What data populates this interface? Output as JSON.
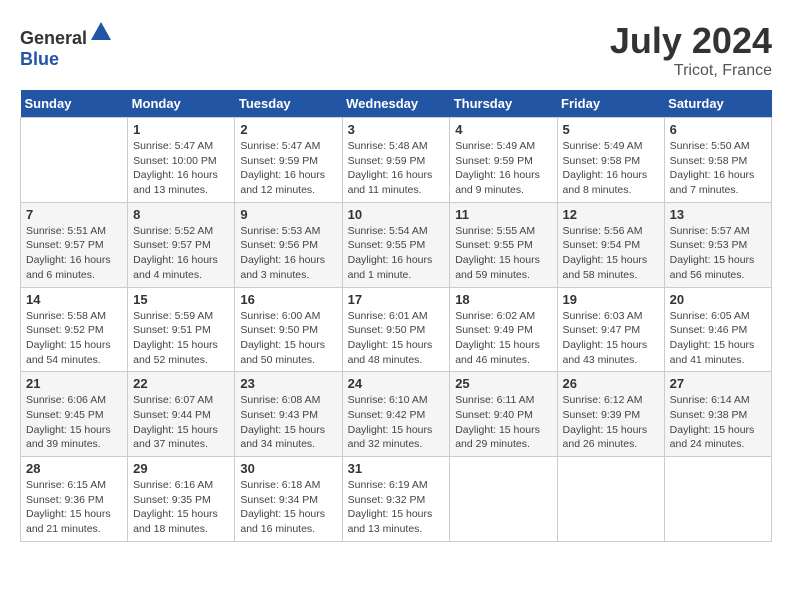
{
  "header": {
    "logo_general": "General",
    "logo_blue": "Blue",
    "month": "July 2024",
    "location": "Tricot, France"
  },
  "calendar": {
    "weekdays": [
      "Sunday",
      "Monday",
      "Tuesday",
      "Wednesday",
      "Thursday",
      "Friday",
      "Saturday"
    ],
    "weeks": [
      [
        {
          "day": "",
          "info": ""
        },
        {
          "day": "1",
          "info": "Sunrise: 5:47 AM\nSunset: 10:00 PM\nDaylight: 16 hours\nand 13 minutes."
        },
        {
          "day": "2",
          "info": "Sunrise: 5:47 AM\nSunset: 9:59 PM\nDaylight: 16 hours\nand 12 minutes."
        },
        {
          "day": "3",
          "info": "Sunrise: 5:48 AM\nSunset: 9:59 PM\nDaylight: 16 hours\nand 11 minutes."
        },
        {
          "day": "4",
          "info": "Sunrise: 5:49 AM\nSunset: 9:59 PM\nDaylight: 16 hours\nand 9 minutes."
        },
        {
          "day": "5",
          "info": "Sunrise: 5:49 AM\nSunset: 9:58 PM\nDaylight: 16 hours\nand 8 minutes."
        },
        {
          "day": "6",
          "info": "Sunrise: 5:50 AM\nSunset: 9:58 PM\nDaylight: 16 hours\nand 7 minutes."
        }
      ],
      [
        {
          "day": "7",
          "info": "Sunrise: 5:51 AM\nSunset: 9:57 PM\nDaylight: 16 hours\nand 6 minutes."
        },
        {
          "day": "8",
          "info": "Sunrise: 5:52 AM\nSunset: 9:57 PM\nDaylight: 16 hours\nand 4 minutes."
        },
        {
          "day": "9",
          "info": "Sunrise: 5:53 AM\nSunset: 9:56 PM\nDaylight: 16 hours\nand 3 minutes."
        },
        {
          "day": "10",
          "info": "Sunrise: 5:54 AM\nSunset: 9:55 PM\nDaylight: 16 hours\nand 1 minute."
        },
        {
          "day": "11",
          "info": "Sunrise: 5:55 AM\nSunset: 9:55 PM\nDaylight: 15 hours\nand 59 minutes."
        },
        {
          "day": "12",
          "info": "Sunrise: 5:56 AM\nSunset: 9:54 PM\nDaylight: 15 hours\nand 58 minutes."
        },
        {
          "day": "13",
          "info": "Sunrise: 5:57 AM\nSunset: 9:53 PM\nDaylight: 15 hours\nand 56 minutes."
        }
      ],
      [
        {
          "day": "14",
          "info": "Sunrise: 5:58 AM\nSunset: 9:52 PM\nDaylight: 15 hours\nand 54 minutes."
        },
        {
          "day": "15",
          "info": "Sunrise: 5:59 AM\nSunset: 9:51 PM\nDaylight: 15 hours\nand 52 minutes."
        },
        {
          "day": "16",
          "info": "Sunrise: 6:00 AM\nSunset: 9:50 PM\nDaylight: 15 hours\nand 50 minutes."
        },
        {
          "day": "17",
          "info": "Sunrise: 6:01 AM\nSunset: 9:50 PM\nDaylight: 15 hours\nand 48 minutes."
        },
        {
          "day": "18",
          "info": "Sunrise: 6:02 AM\nSunset: 9:49 PM\nDaylight: 15 hours\nand 46 minutes."
        },
        {
          "day": "19",
          "info": "Sunrise: 6:03 AM\nSunset: 9:47 PM\nDaylight: 15 hours\nand 43 minutes."
        },
        {
          "day": "20",
          "info": "Sunrise: 6:05 AM\nSunset: 9:46 PM\nDaylight: 15 hours\nand 41 minutes."
        }
      ],
      [
        {
          "day": "21",
          "info": "Sunrise: 6:06 AM\nSunset: 9:45 PM\nDaylight: 15 hours\nand 39 minutes."
        },
        {
          "day": "22",
          "info": "Sunrise: 6:07 AM\nSunset: 9:44 PM\nDaylight: 15 hours\nand 37 minutes."
        },
        {
          "day": "23",
          "info": "Sunrise: 6:08 AM\nSunset: 9:43 PM\nDaylight: 15 hours\nand 34 minutes."
        },
        {
          "day": "24",
          "info": "Sunrise: 6:10 AM\nSunset: 9:42 PM\nDaylight: 15 hours\nand 32 minutes."
        },
        {
          "day": "25",
          "info": "Sunrise: 6:11 AM\nSunset: 9:40 PM\nDaylight: 15 hours\nand 29 minutes."
        },
        {
          "day": "26",
          "info": "Sunrise: 6:12 AM\nSunset: 9:39 PM\nDaylight: 15 hours\nand 26 minutes."
        },
        {
          "day": "27",
          "info": "Sunrise: 6:14 AM\nSunset: 9:38 PM\nDaylight: 15 hours\nand 24 minutes."
        }
      ],
      [
        {
          "day": "28",
          "info": "Sunrise: 6:15 AM\nSunset: 9:36 PM\nDaylight: 15 hours\nand 21 minutes."
        },
        {
          "day": "29",
          "info": "Sunrise: 6:16 AM\nSunset: 9:35 PM\nDaylight: 15 hours\nand 18 minutes."
        },
        {
          "day": "30",
          "info": "Sunrise: 6:18 AM\nSunset: 9:34 PM\nDaylight: 15 hours\nand 16 minutes."
        },
        {
          "day": "31",
          "info": "Sunrise: 6:19 AM\nSunset: 9:32 PM\nDaylight: 15 hours\nand 13 minutes."
        },
        {
          "day": "",
          "info": ""
        },
        {
          "day": "",
          "info": ""
        },
        {
          "day": "",
          "info": ""
        }
      ]
    ]
  }
}
